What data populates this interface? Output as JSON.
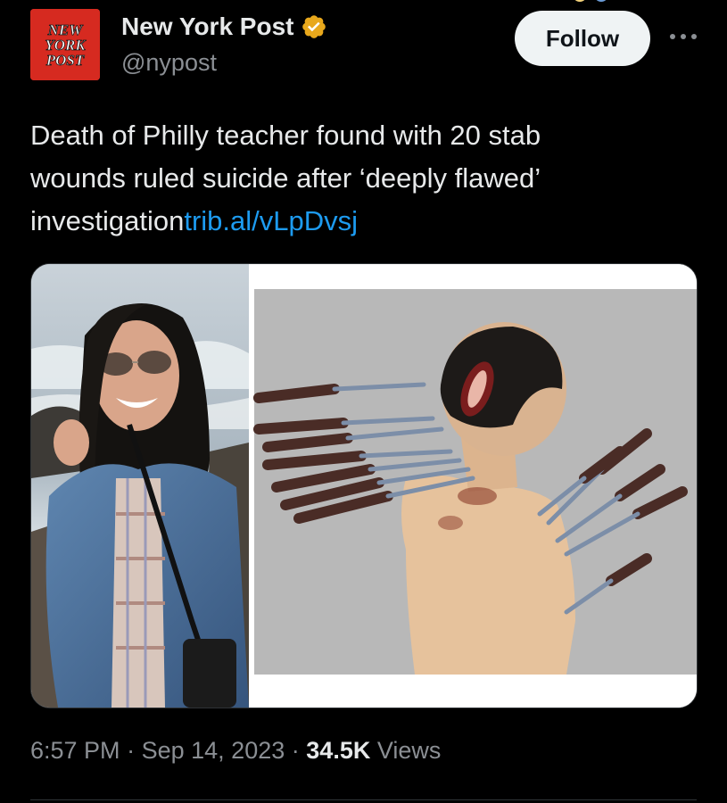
{
  "author": {
    "display_name": "New York Post",
    "handle": "@nypost",
    "verified": true,
    "verified_color": "#e8a81c",
    "avatar_color": "#d62a20",
    "avatar_logo_text": [
      "NEW",
      "YORK",
      "POST"
    ]
  },
  "actions": {
    "follow_label": "Follow",
    "more_icon": "more-horizontal-icon"
  },
  "tweet": {
    "text_lines": [
      "Death of Philly teacher found with 20 stab",
      "wounds ruled suicide after ‘deeply flawed’",
      "investigation"
    ],
    "link": "trib.al/vLpDvsj",
    "link_color": "#1d9bf0"
  },
  "media": {
    "left_image": "photo-woman-smiling-sunglasses-denim-jacket",
    "right_image": "diagram-illustration-knives-wounds"
  },
  "meta": {
    "time": "6:57 PM",
    "separator": "·",
    "date": "Sep 14, 2023",
    "views_count": "34.5K",
    "views_label": "Views"
  },
  "colors": {
    "background": "#000000",
    "text_primary": "#e7e9ea",
    "text_secondary": "#8b8f94"
  }
}
